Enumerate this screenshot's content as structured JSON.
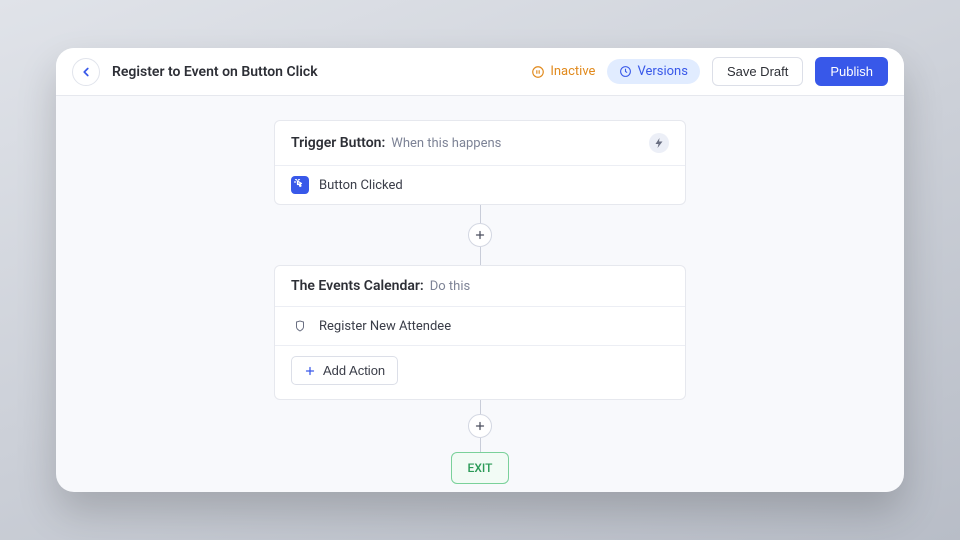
{
  "header": {
    "title": "Register to Event on Button Click",
    "status_label": "Inactive",
    "versions_label": "Versions",
    "save_label": "Save Draft",
    "publish_label": "Publish"
  },
  "trigger_card": {
    "title": "Trigger Button:",
    "subtitle": "When this happens",
    "item_label": "Button Clicked"
  },
  "action_card": {
    "title": "The Events Calendar:",
    "subtitle": "Do this",
    "item_label": "Register New Attendee",
    "add_action_label": "Add Action"
  },
  "exit_label": "EXIT"
}
